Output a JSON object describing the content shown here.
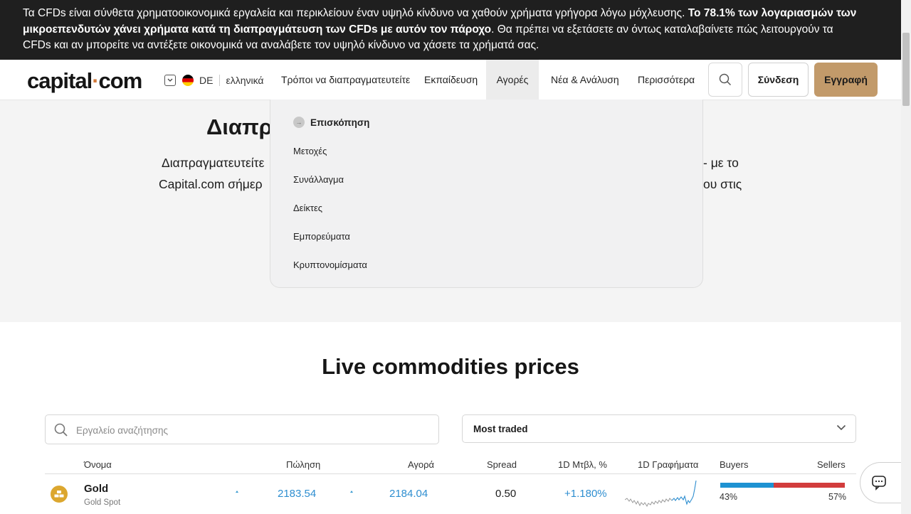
{
  "risk_banner": {
    "part1": "Τα CFDs είναι σύνθετα χρηματοοικονομικά εργαλεία και περικλείουν έναν υψηλό κίνδυνο να χαθούν χρήματα γρήγορα λόγω μόχλευσης. ",
    "bold_a": "Το 78.1% των λογαριασμών των",
    "bold_b": "μικροεπενδυτών χάνει χρήματα κατά τη διαπραγμάτευση των CFDs με αυτόν τον πάροχο",
    "part2": ". Θα πρέπει να εξετάσετε αν όντως καταλαβαίνετε πώς λειτουργούν τα",
    "part3": "CFDs και αν μπορείτε να αντέξετε οικονομικά να αναλάβετε τον υψηλό κίνδυνο να χάσετε τα χρήματά σας."
  },
  "header": {
    "logo_left": "capital",
    "logo_dot": "·",
    "logo_right": "com",
    "lang_code": "DE",
    "lang_name": "ελληνικά",
    "nav": {
      "ways": "Τρόποι να διαπραγματευτείτε",
      "education": "Εκπαίδευση",
      "markets": "Αγορές",
      "news": "Νέα & Ανάλυση",
      "more": "Περισσότερα"
    },
    "login": "Σύνδεση",
    "signup": "Εγγραφή"
  },
  "hero": {
    "title": "Διαπρ",
    "line1": "Διαπραγματευτείτε",
    "line2": "Capital.com σήμερ",
    "line1_end": "- με το",
    "line2_end": "ου στις"
  },
  "markets_menu": {
    "overview": "Επισκόπηση",
    "items": [
      "Μετοχές",
      "Συνάλλαγμα",
      "Δείκτες",
      "Εμπορεύματα",
      "Κρυπτονομίσματα"
    ]
  },
  "live": {
    "title": "Live commodities prices",
    "search_placeholder": "Εργαλείο αναζήτησης",
    "sort_value": "Most traded",
    "columns": {
      "name": "Όνομα",
      "sell": "Πώληση",
      "buy": "Αγορά",
      "spread": "Spread",
      "change": "1D Μτβλ, %",
      "chart": "1D Γραφήματα",
      "buyers": "Buyers",
      "sellers": "Sellers"
    },
    "rows": [
      {
        "name": "Gold",
        "sub": "Gold Spot",
        "sell": "2183.54",
        "buy": "2184.04",
        "spread": "0.50",
        "change": "+1.180%",
        "buyers_pct": "43%",
        "sellers_pct": "57%",
        "buyers_fraction": 0.43
      }
    ]
  },
  "colors": {
    "banner_bg": "#1f1f1f",
    "signup": "#c29a6a",
    "accent_blue": "#2e8ed0",
    "buyers": "#1e92d2",
    "sellers": "#d23c3c",
    "gold": "#dca72f"
  }
}
